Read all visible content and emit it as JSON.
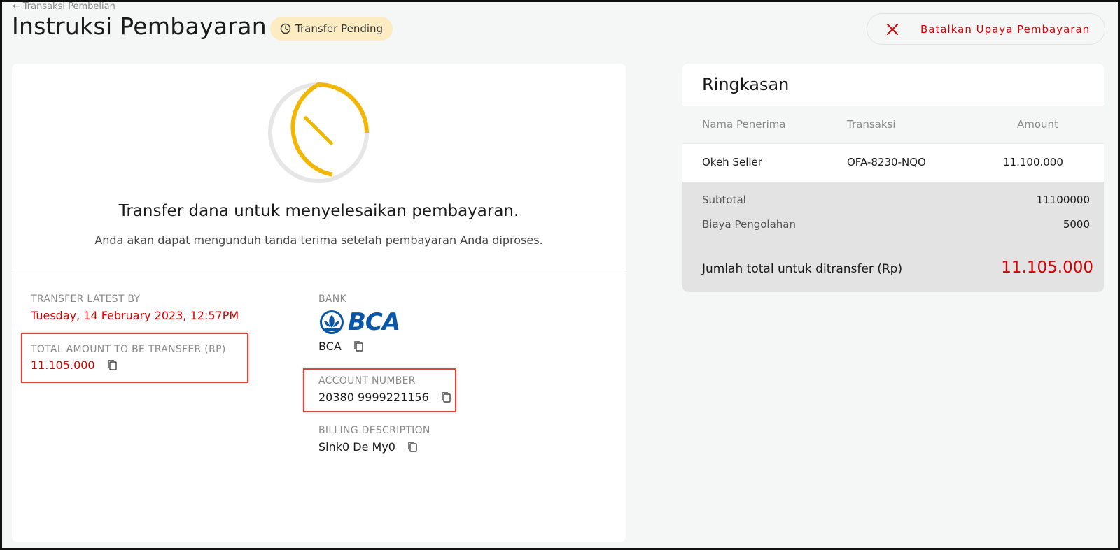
{
  "header": {
    "back_label": "Transaksi Pembelian",
    "title": "Instruksi Pembayaran",
    "status_badge": "Transfer Pending",
    "cancel_label": "Batalkan Upaya Pembayaran"
  },
  "instructions": {
    "heading": "Transfer dana untuk menyelesaikan pembayaran.",
    "subheading": "Anda akan dapat mengunduh tanda terima setelah pembayaran Anda diproses.",
    "transfer_latest_label": "TRANSFER LATEST BY",
    "transfer_latest_value": "Tuesday, 14 February 2023, 12:57PM",
    "total_amount_label": "TOTAL AMOUNT TO BE TRANSFER (RP)",
    "total_amount_value": "11.105.000",
    "bank_label": "BANK",
    "bank_logo_text": "BCA",
    "bank_value": "BCA",
    "account_number_label": "ACCOUNT NUMBER",
    "account_number_value": "20380 9999221156",
    "billing_label": "BILLING DESCRIPTION",
    "billing_value": "Sink0 De My0"
  },
  "summary": {
    "title": "Ringkasan",
    "columns": [
      "Nama Penerima",
      "Transaksi",
      "Amount"
    ],
    "rows": [
      {
        "recipient": "Okeh Seller",
        "transaction": "OFA-8230-NQO",
        "amount": "11.100.000"
      }
    ],
    "subtotal_label": "Subtotal",
    "subtotal_value": "11100000",
    "fee_label": "Biaya Pengolahan",
    "fee_value": "5000",
    "grand_total_label": "Jumlah total untuk ditransfer (Rp)",
    "grand_total_value": "11.105.000"
  },
  "colors": {
    "accent_red": "#d40000",
    "pending_yellow": "#f2b705",
    "badge_bg": "#fdebc2",
    "bca_blue": "#0a56a6"
  },
  "icons": [
    "arrow-left-icon",
    "clock-icon",
    "close-icon",
    "timer-icon",
    "copy-icon",
    "bca-logo"
  ]
}
